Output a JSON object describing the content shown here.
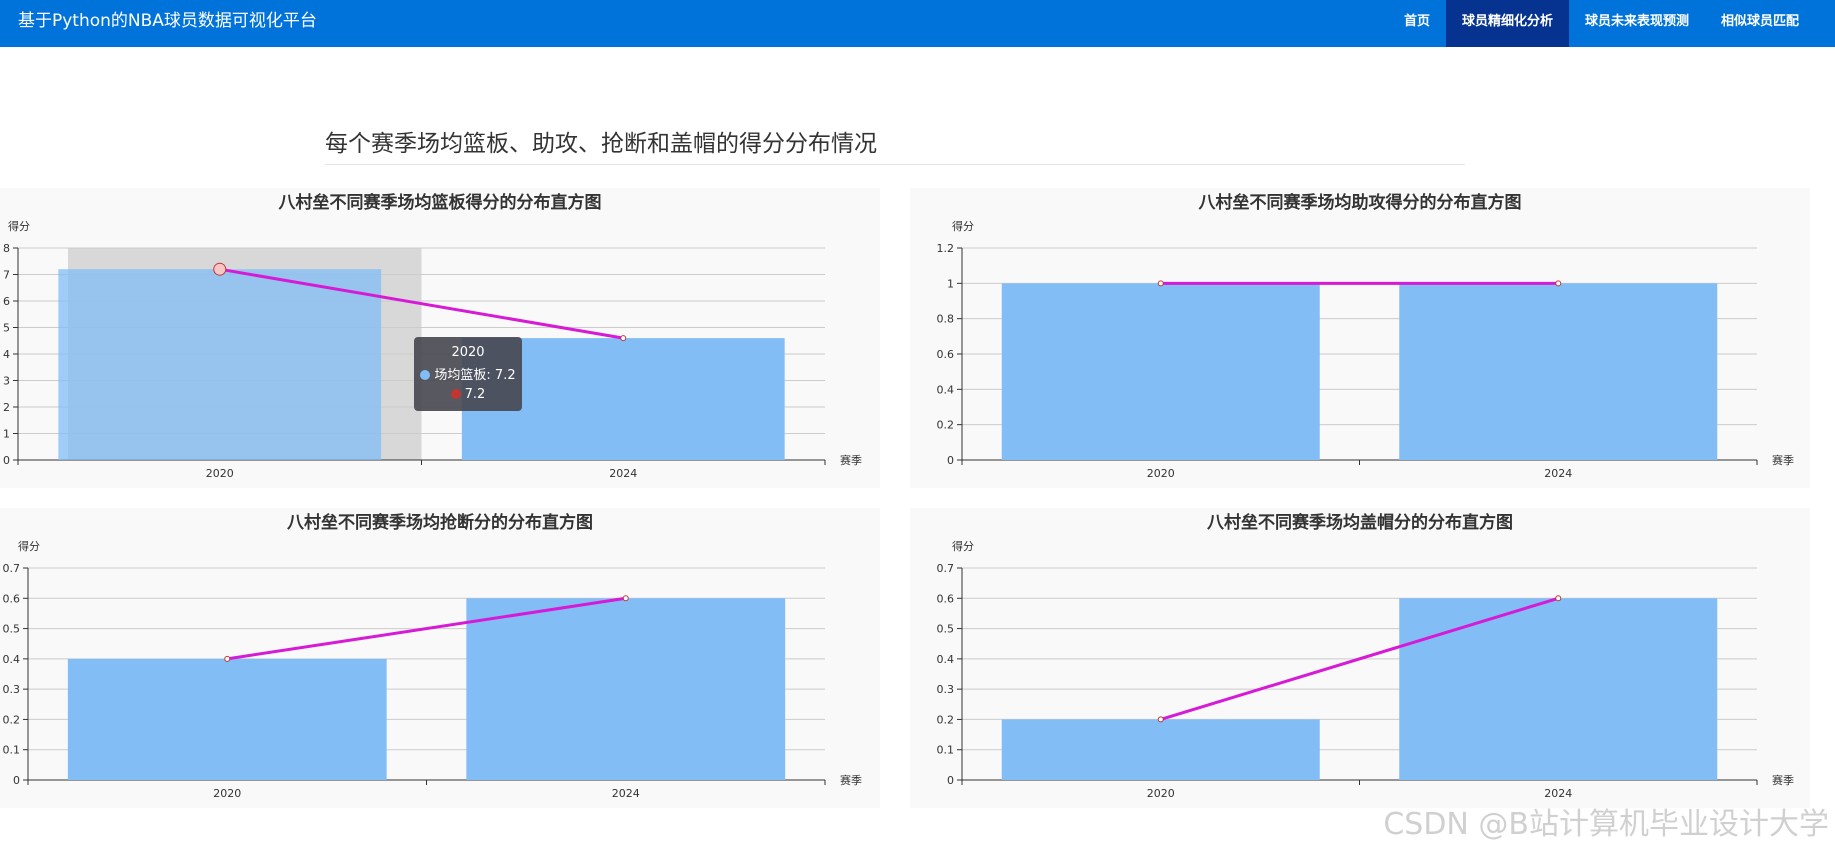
{
  "app": {
    "title": "基于Python的NBA球员数据可视化平台"
  },
  "nav": [
    {
      "label": "首页",
      "active": false
    },
    {
      "label": "球员精细化分析",
      "active": true
    },
    {
      "label": "球员未来表现预测",
      "active": false
    },
    {
      "label": "相似球员匹配",
      "active": false
    }
  ],
  "section": {
    "title": "每个赛季场均篮板、助攻、抢断和盖帽的得分分布情况"
  },
  "colors": {
    "bar": "#82bdf6",
    "line": "#d61ad6",
    "nav": "#0073db",
    "nav_active": "#073390"
  },
  "tooltip": {
    "title": "2020",
    "series_line": "场均篮板: 7.2",
    "pin_line": "7.2"
  },
  "watermark": "CSDN @B站计算机毕业设计大学",
  "chart_data": [
    {
      "type": "bar",
      "title": "八村垒不同赛季场均篮板得分的分布直方图",
      "ylabel": "得分",
      "xlabel": "赛季",
      "categories": [
        "2020",
        "2024"
      ],
      "series": [
        {
          "name": "场均篮板",
          "values": [
            7.2,
            4.6
          ]
        }
      ],
      "line_overlay": [
        7.2,
        4.6
      ],
      "ylim": [
        0,
        8
      ],
      "yticks": [
        "0",
        "1",
        "2",
        "3",
        "4",
        "5",
        "6",
        "7",
        "8"
      ],
      "highlight_category": "2020"
    },
    {
      "type": "bar",
      "title": "八村垒不同赛季场均助攻得分的分布直方图",
      "ylabel": "得分",
      "xlabel": "赛季",
      "categories": [
        "2020",
        "2024"
      ],
      "series": [
        {
          "values": [
            1,
            1
          ]
        }
      ],
      "line_overlay": [
        1,
        1
      ],
      "ylim": [
        0,
        1.2
      ],
      "yticks": [
        "0",
        "0.2",
        "0.4",
        "0.6",
        "0.8",
        "1",
        "1.2"
      ]
    },
    {
      "type": "bar",
      "title": "八村垒不同赛季场均抢断分的分布直方图",
      "ylabel": "得分",
      "xlabel": "赛季",
      "categories": [
        "2020",
        "2024"
      ],
      "series": [
        {
          "values": [
            0.4,
            0.6
          ]
        }
      ],
      "line_overlay": [
        0.4,
        0.6
      ],
      "ylim": [
        0,
        0.7
      ],
      "yticks": [
        "0",
        "0.1",
        "0.2",
        "0.3",
        "0.4",
        "0.5",
        "0.6",
        "0.7"
      ]
    },
    {
      "type": "bar",
      "title": "八村垒不同赛季场均盖帽分的分布直方图",
      "ylabel": "得分",
      "xlabel": "赛季",
      "categories": [
        "2020",
        "2024"
      ],
      "series": [
        {
          "values": [
            0.2,
            0.6
          ]
        }
      ],
      "line_overlay": [
        0.2,
        0.6
      ],
      "ylim": [
        0,
        0.7
      ],
      "yticks": [
        "0",
        "0.1",
        "0.2",
        "0.3",
        "0.4",
        "0.5",
        "0.6",
        "0.7"
      ]
    }
  ]
}
